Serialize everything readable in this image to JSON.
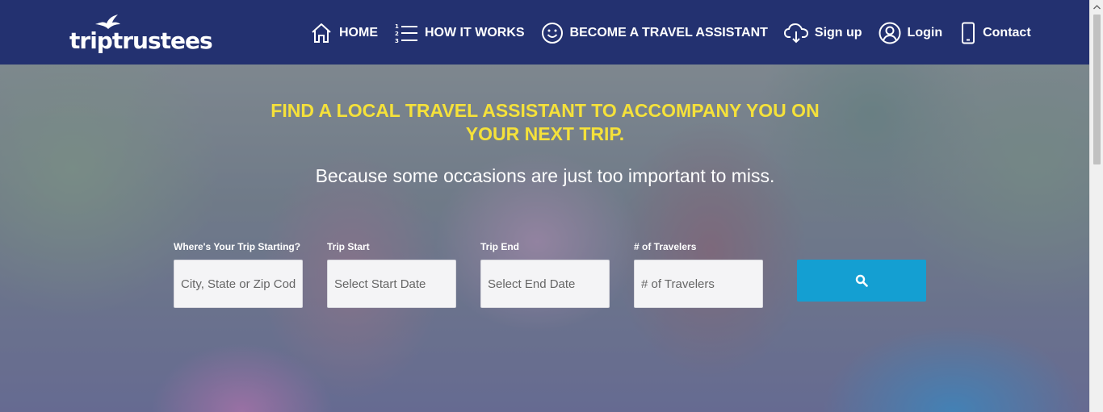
{
  "header": {
    "logo_text": "triptrustees",
    "nav": [
      {
        "label": "HOME",
        "icon": "home-icon"
      },
      {
        "label": "HOW IT WORKS",
        "icon": "numbered-list-icon"
      },
      {
        "label": "BECOME A TRAVEL ASSISTANT",
        "icon": "smiley-icon"
      },
      {
        "label": "Sign up",
        "icon": "cloud-download-icon"
      },
      {
        "label": "Login",
        "icon": "user-icon"
      },
      {
        "label": "Contact",
        "icon": "phone-icon"
      }
    ]
  },
  "hero": {
    "headline": "FIND A LOCAL TRAVEL ASSISTANT TO ACCOMPANY YOU ON YOUR NEXT TRIP.",
    "subheadline": "Because some occasions are just too important to miss."
  },
  "search": {
    "fields": [
      {
        "label": "Where's Your Trip Starting?",
        "placeholder": "City, State or Zip Code"
      },
      {
        "label": "Trip Start",
        "placeholder": "Select Start Date"
      },
      {
        "label": "Trip End",
        "placeholder": "Select End Date"
      },
      {
        "label": "# of Travelers",
        "placeholder": "# of Travelers"
      }
    ],
    "button_icon": "search-icon"
  },
  "colors": {
    "nav_bg": "#233170",
    "headline": "#f5e13a",
    "search_button": "#149fd2"
  }
}
